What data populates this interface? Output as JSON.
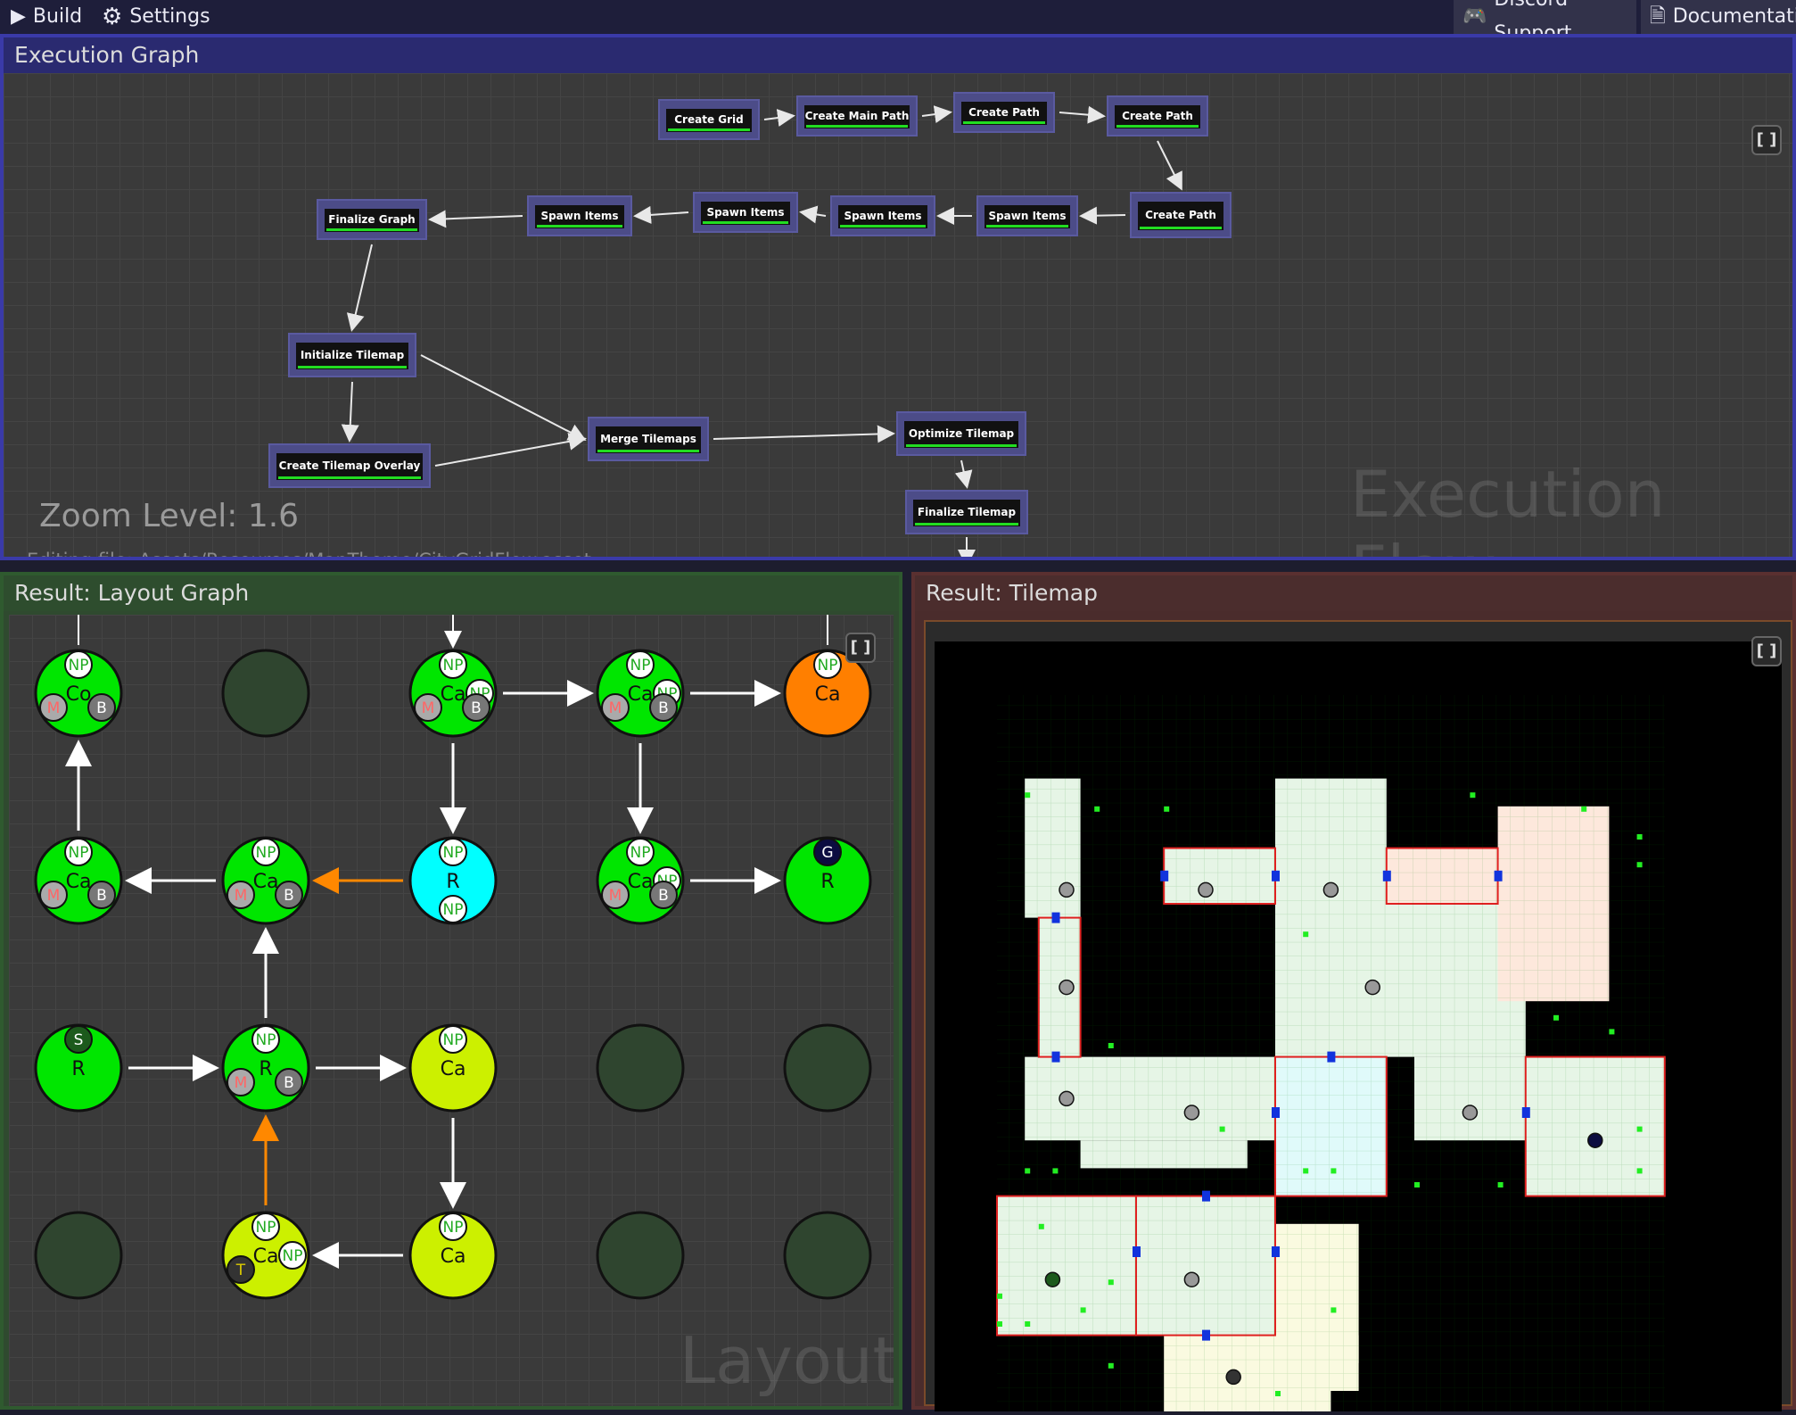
{
  "toolbar": {
    "build_label": "Build",
    "settings_label": "Settings",
    "discord_label": "Discord Support",
    "docs_label": "Documentation"
  },
  "execution_graph": {
    "title": "Execution Graph",
    "watermark": "Execution Flow",
    "zoom_text": "Zoom Level: 1.6",
    "editing_text": "Editing file: Assets/Resources/MapTheme/CityGridFlow.asset",
    "nodes": {
      "create_grid": "Create Grid",
      "create_main_path": "Create Main Path",
      "create_path_1": "Create Path",
      "create_path_2": "Create Path",
      "create_path_3": "Create Path",
      "spawn_items_1": "Spawn Items",
      "spawn_items_2": "Spawn Items",
      "spawn_items_3": "Spawn Items",
      "spawn_items_4": "Spawn Items",
      "finalize_graph": "Finalize Graph",
      "initialize_tilemap": "Initialize Tilemap",
      "create_tilemap_overlay": "Create Tilemap Overlay",
      "merge_tilemaps": "Merge Tilemaps",
      "optimize_tilemap": "Optimize Tilemap",
      "finalize_tilemap": "Finalize Tilemap"
    }
  },
  "layout_graph": {
    "title": "Result: Layout Graph",
    "watermark": "Layout",
    "node_labels": {
      "co": "Co",
      "ca": "Ca",
      "r": "R",
      "s": "S",
      "g": "G",
      "t": "T",
      "np": "NP",
      "m": "M",
      "b": "B"
    }
  },
  "tilemap_panel": {
    "title": "Result: Tilemap"
  },
  "colors": {
    "topbar": "#1e1e3a",
    "exec_border": "#3a3aa8",
    "node_fill": "#4a4a8a",
    "node_green_bar": "#22dd22",
    "room_green": "#00e600",
    "room_cyan": "#00ffff",
    "room_orange": "#ff7f00",
    "room_yellow": "#ccf000",
    "room_empty": "#2f452f",
    "orange_link": "#ff8800"
  }
}
